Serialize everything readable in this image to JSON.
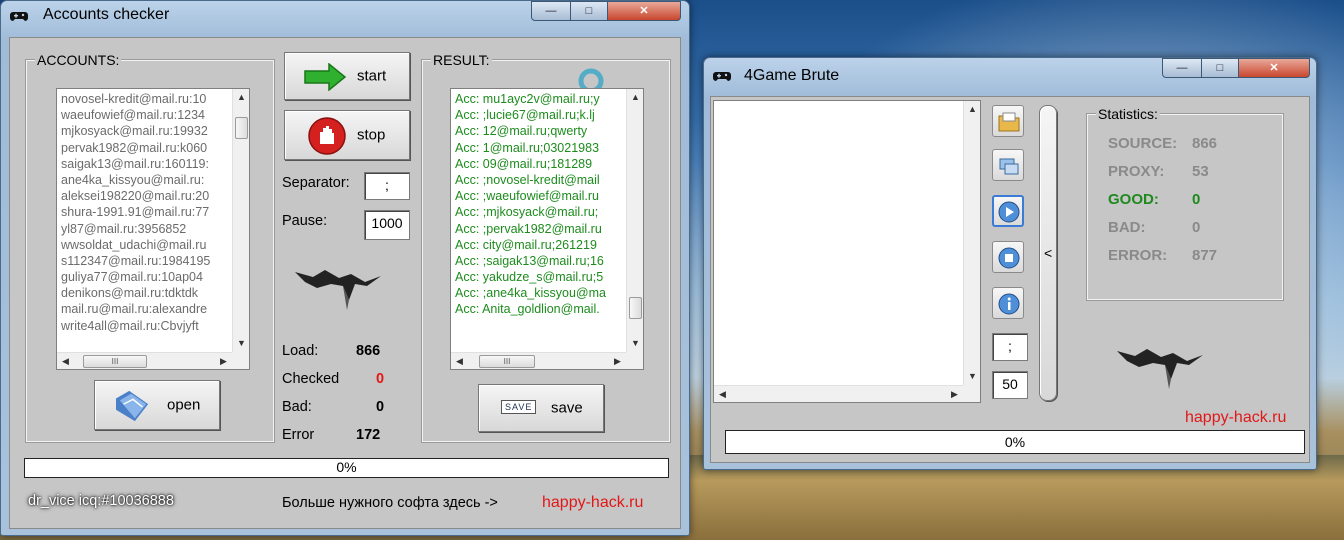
{
  "accounts_window": {
    "title": "Accounts checker",
    "controls": {
      "minimize": "—",
      "maximize": "□",
      "close": "✕"
    },
    "accounts_group": "ACCOUNTS:",
    "accounts_list": [
      "novosel-kredit@mail.ru:10",
      "waeufowief@mail.ru:1234",
      "mjkosyack@mail.ru:19932",
      "pervak1982@mail.ru:k060",
      "saigak13@mail.ru:160119:",
      "ane4ka_kissyou@mail.ru:",
      "aleksei198220@mail.ru:20",
      "shura-1991.91@mail.ru:77",
      "yl87@mail.ru:3956852",
      "wwsoldat_udachi@mail.ru",
      "s112347@mail.ru:1984195",
      "guliya77@mail.ru:10ap04",
      "denikons@mail.ru:tdktdk",
      "mail.ru@mail.ru:alexandre",
      "write4all@mail.ru:Cbvjyft"
    ],
    "open_label": "open",
    "start_label": "start",
    "stop_label": "stop",
    "separator_label": "Separator:",
    "separator_value": ";",
    "pause_label": "Pause:",
    "pause_value": "1000",
    "stats": {
      "load_label": "Load:",
      "load_value": "866",
      "checked_label": "Checked",
      "checked_value": "0",
      "bad_label": "Bad:",
      "bad_value": "0",
      "error_label": "Error",
      "error_value": "172"
    },
    "result_group": "RESULT:",
    "result_list": [
      "Acc: mu1ayc2v@mail.ru;y",
      "Acc: ;lucie67@mail.ru;k.lj",
      "Acc: 12@mail.ru;qwerty",
      "Acc: 1@mail.ru;03021983",
      "Acc: 09@mail.ru;181289",
      "Acc: ;novosel-kredit@mail",
      "Acc: ;waeufowief@mail.ru",
      "Acc: ;mjkosyack@mail.ru;",
      "Acc: ;pervak1982@mail.ru",
      "Acc: city@mail.ru;261219",
      "Acc: ;saigak13@mail.ru;16",
      "Acc: yakudze_s@mail.ru;5",
      "Acc: ;ane4ka_kissyou@ma",
      "Acc: Anita_goldlion@mail."
    ],
    "save_icon_text": "SAVE",
    "save_label": "save",
    "progress_text": "0%",
    "progress_value": 0,
    "footer_author": "dr_vice icq:#10036888",
    "footer_text": "Больше нужного софта здесь ->",
    "footer_link": "happy-hack.ru"
  },
  "brute_window": {
    "title": "4Game Brute",
    "controls": {
      "minimize": "—",
      "maximize": "□",
      "close": "✕"
    },
    "separator_value": ";",
    "threads_value": "50",
    "collapse_label": "<",
    "statistics_group": "Statistics:",
    "stats": [
      {
        "key": "SOURCE:",
        "value": "866",
        "color": "#8a8a8a"
      },
      {
        "key": "PROXY:",
        "value": "53",
        "color": "#8a8a8a"
      },
      {
        "key": "GOOD:",
        "value": "0",
        "color": "#1e8a1e"
      },
      {
        "key": "BAD:",
        "value": "0",
        "color": "#8a8a8a"
      },
      {
        "key": "ERROR:",
        "value": "877",
        "color": "#8a8a8a"
      }
    ],
    "link": "happy-hack.ru",
    "progress_text": "0%",
    "progress_value": 0
  },
  "colors": {
    "link_red": "#e21818",
    "checked_red": "#e21818",
    "result_green": "#1d8c1d"
  }
}
